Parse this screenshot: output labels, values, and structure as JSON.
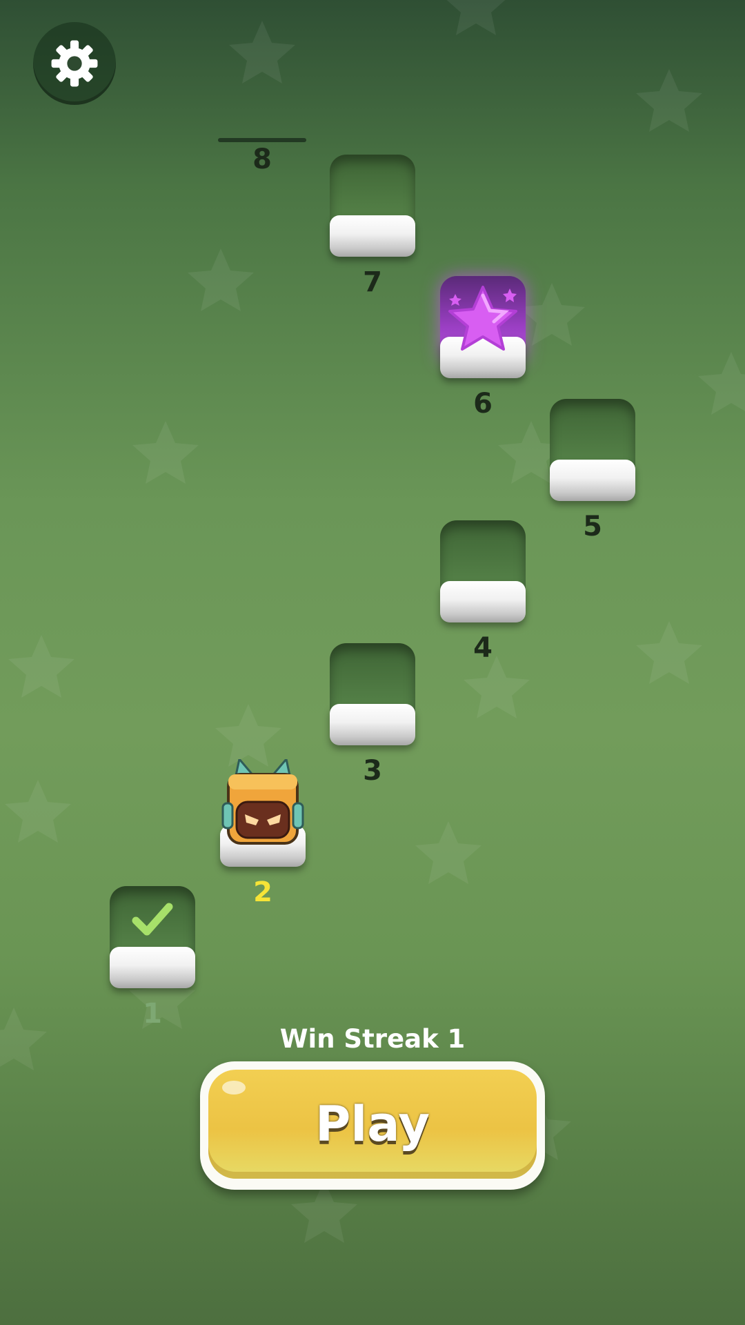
{
  "settings": {
    "icon": "gear-icon"
  },
  "levels": [
    {
      "id": 1,
      "label": "1",
      "state": "completed",
      "icon": "checkmark-icon"
    },
    {
      "id": 2,
      "label": "2",
      "state": "current",
      "icon": "robot-character-icon"
    },
    {
      "id": 3,
      "label": "3",
      "state": "locked"
    },
    {
      "id": 4,
      "label": "4",
      "state": "locked"
    },
    {
      "id": 5,
      "label": "5",
      "state": "locked"
    },
    {
      "id": 6,
      "label": "6",
      "state": "reward",
      "icon": "purple-star-icon"
    },
    {
      "id": 7,
      "label": "7",
      "state": "locked"
    },
    {
      "id": 8,
      "label": "8",
      "state": "locked"
    }
  ],
  "footer": {
    "streak_label": "Win Streak 1",
    "play_label": "Play"
  },
  "colors": {
    "background": "#6a9657",
    "play_button": "#ecc344",
    "current_level_number": "#f6e437",
    "completed_check": "#a7e06a",
    "reward_star": "#d85ef2"
  }
}
